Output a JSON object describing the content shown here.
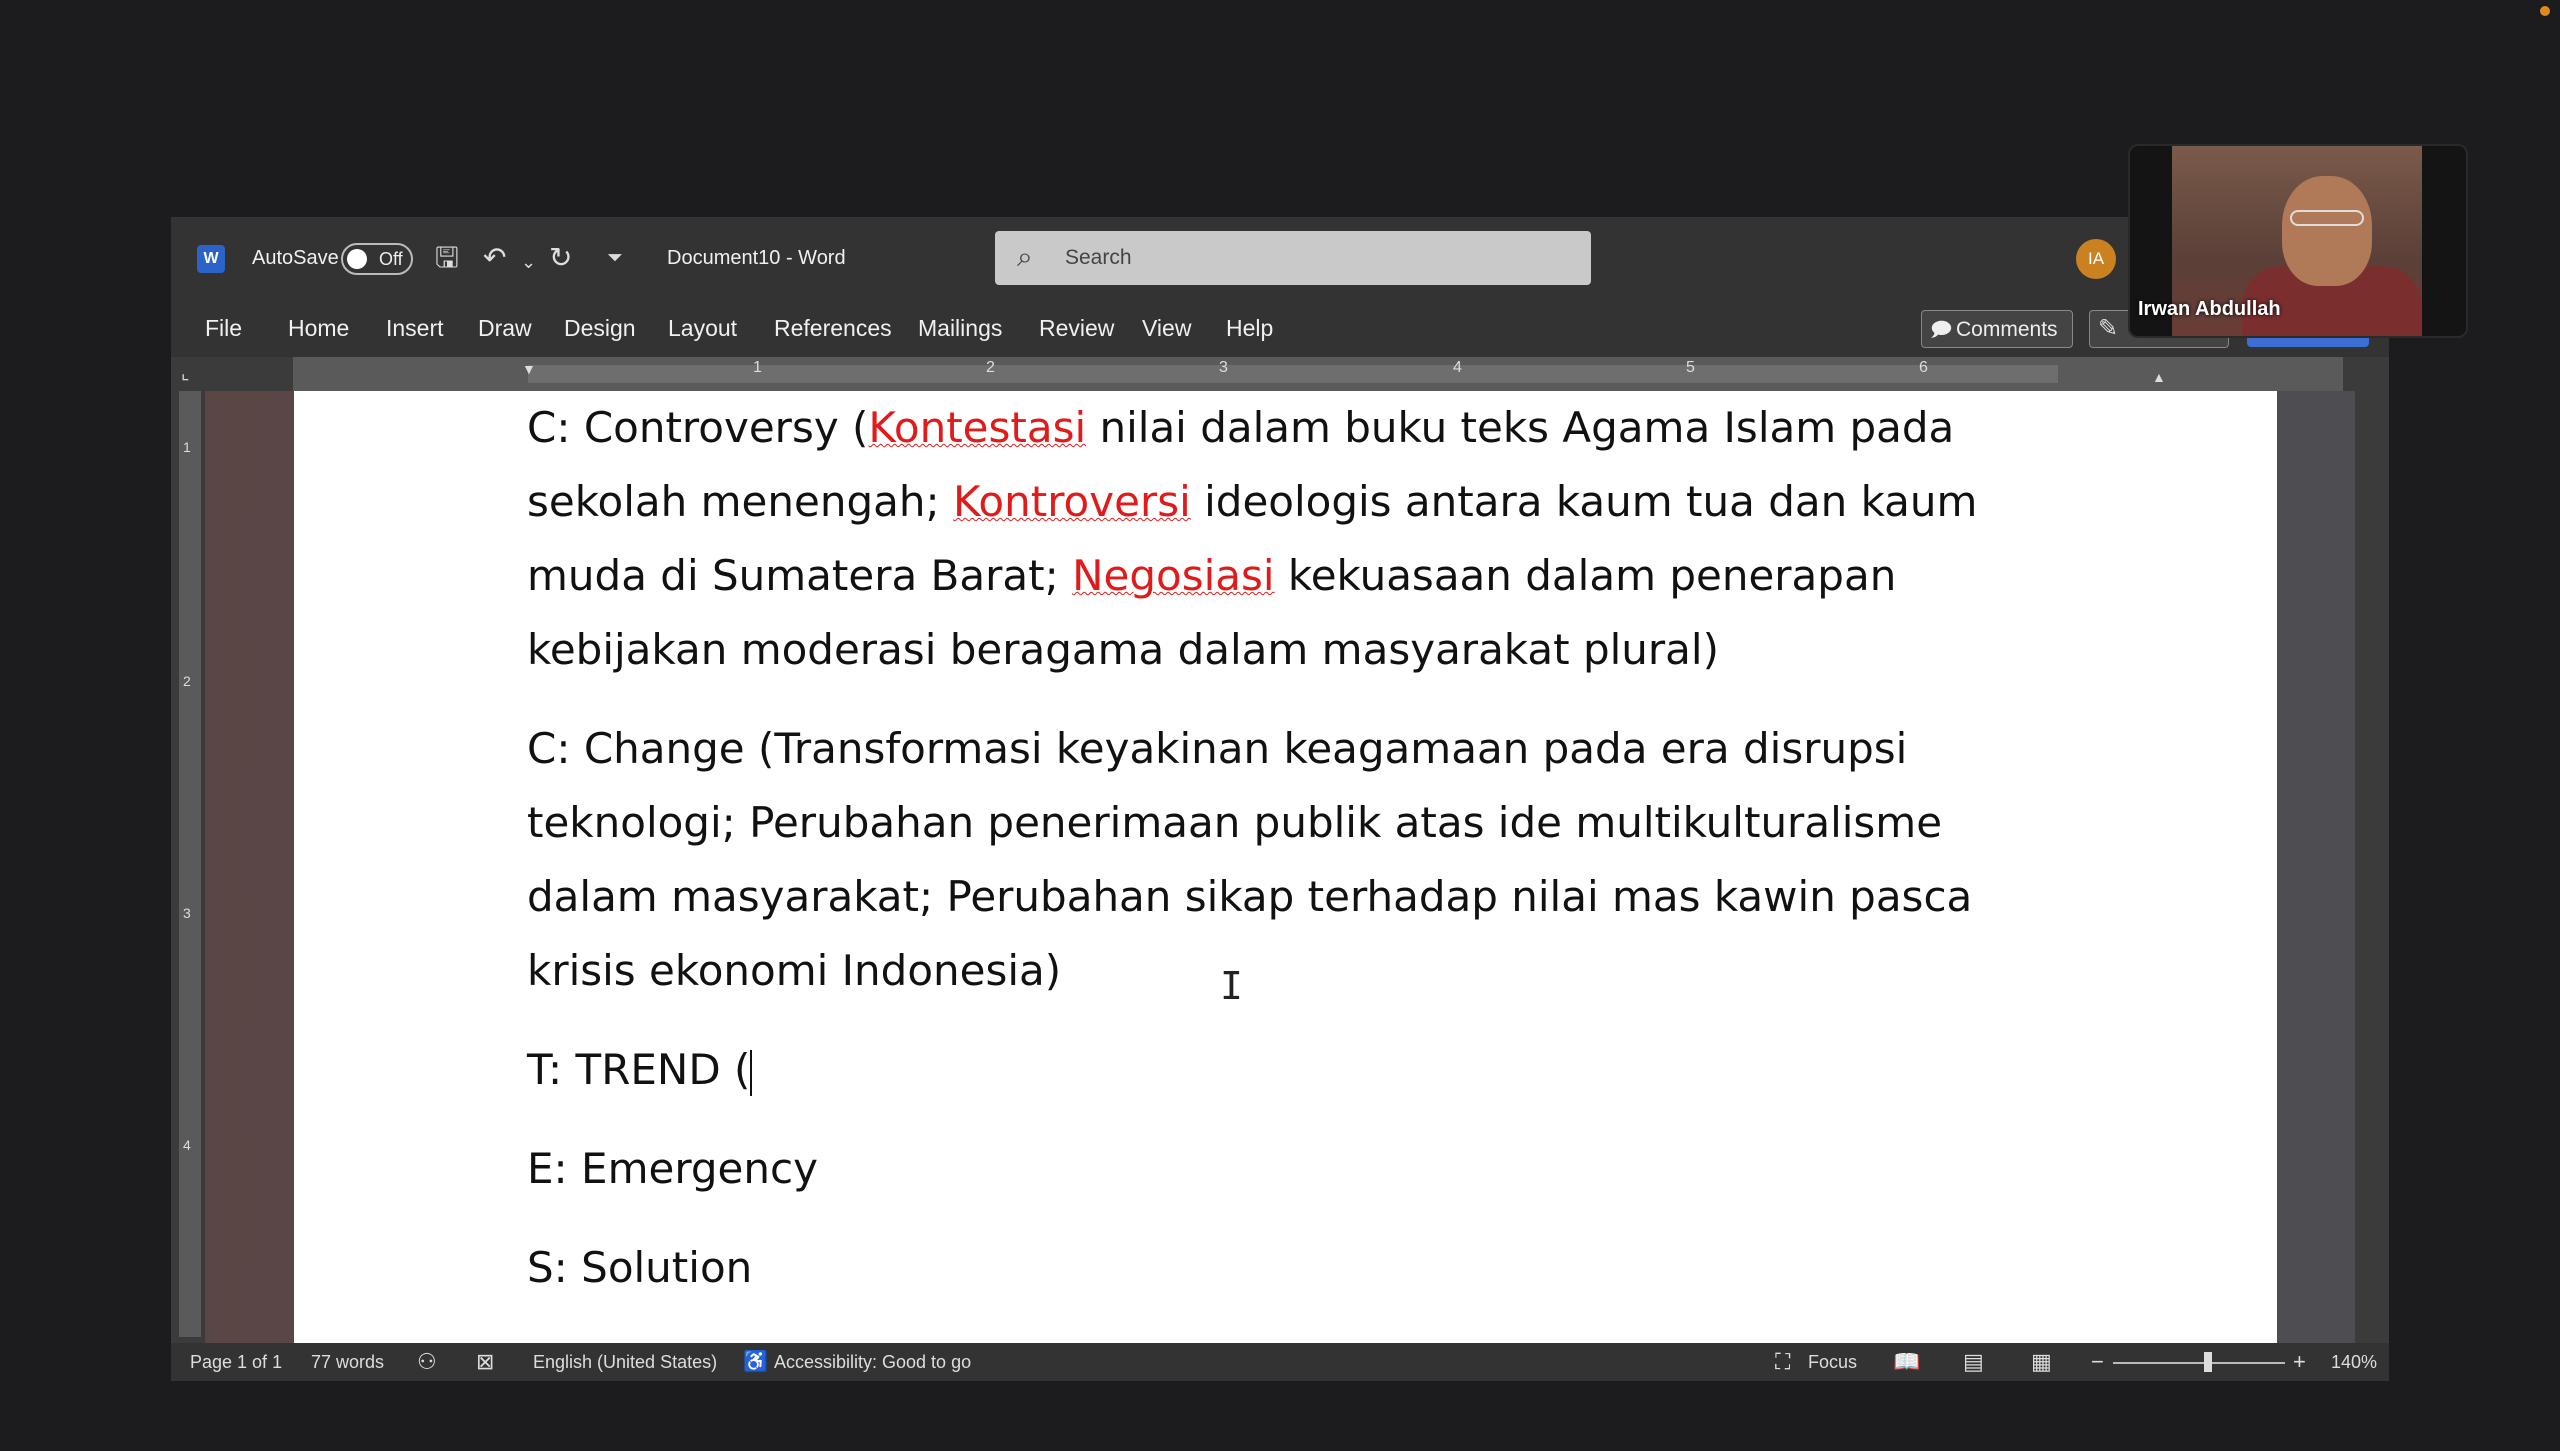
{
  "titlebar": {
    "autosave_label": "AutoSave",
    "autosave_state": "Off",
    "document_title": "Document10  -  Word",
    "search_placeholder": "Search",
    "user_initials": "IA"
  },
  "menu": {
    "items": [
      "File",
      "Home",
      "Insert",
      "Draw",
      "Design",
      "Layout",
      "References",
      "Mailings",
      "Review",
      "View",
      "Help"
    ],
    "comments_label": "Comments"
  },
  "ruler": {
    "h_numbers": [
      "1",
      "2",
      "3",
      "4",
      "5",
      "6"
    ],
    "v_numbers": [
      "1",
      "2",
      "3",
      "4"
    ]
  },
  "document": {
    "p1": {
      "a": "C: Controversy (",
      "b": "Kontestasi",
      "c": " nilai dalam buku teks Agama Islam pada sekolah menengah; ",
      "d": "Kontroversi",
      "e": " ideologis antara kaum tua dan kaum muda di Sumatera Barat; ",
      "f": "Negosiasi",
      "g": " kekuasaan dalam penerapan kebijakan moderasi beragama dalam masyarakat plural)"
    },
    "p2": "C: Change (Transformasi keyakinan keagamaan pada era disrupsi teknologi; Perubahan penerimaan publik atas ide multikulturalisme dalam masyarakat; Perubahan sikap terhadap nilai mas kawin pasca krisis ekonomi Indonesia)",
    "p3": "T: TREND (",
    "p4": "E: Emergency",
    "p5": "S: Solution"
  },
  "statusbar": {
    "page": "Page 1 of 1",
    "words": "77 words",
    "language": "English (United States)",
    "accessibility": "Accessibility: Good to go",
    "focus": "Focus",
    "zoom": "140%"
  },
  "video": {
    "participant_name": "Irwan Abdullah"
  },
  "colors": {
    "accent_red": "#e01b1b",
    "avatar": "#c9821f",
    "share_button": "#3b6fd4"
  }
}
